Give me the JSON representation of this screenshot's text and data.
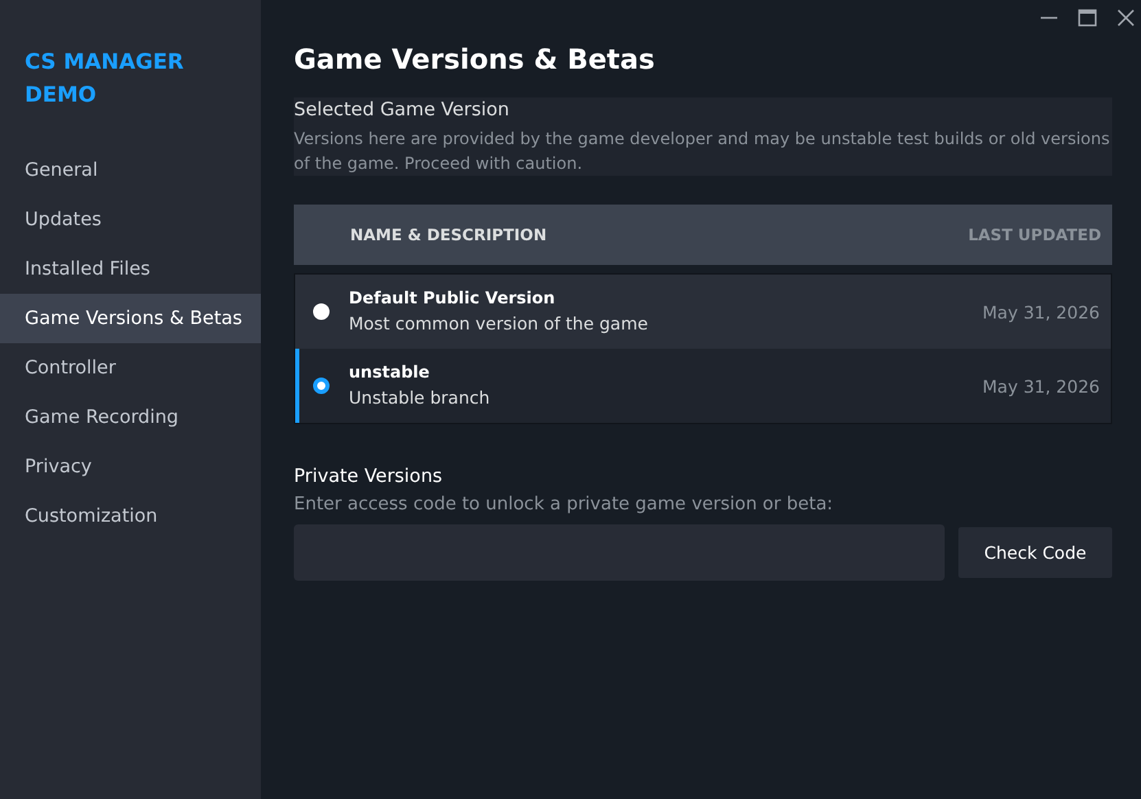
{
  "sidebar": {
    "title": "CS MANAGER DEMO",
    "items": [
      {
        "label": "General",
        "selected": false
      },
      {
        "label": "Updates",
        "selected": false
      },
      {
        "label": "Installed Files",
        "selected": false
      },
      {
        "label": "Game Versions & Betas",
        "selected": true
      },
      {
        "label": "Controller",
        "selected": false
      },
      {
        "label": "Game Recording",
        "selected": false
      },
      {
        "label": "Privacy",
        "selected": false
      },
      {
        "label": "Customization",
        "selected": false
      }
    ]
  },
  "page": {
    "title": "Game Versions & Betas"
  },
  "selected_version": {
    "heading": "Selected Game Version",
    "description": "Versions here are provided by the game developer and may be unstable test builds or old versions of the game. Proceed with caution."
  },
  "table": {
    "columns": [
      "NAME & DESCRIPTION",
      "LAST UPDATED"
    ],
    "rows": [
      {
        "name": "Default Public Version",
        "description": "Most common version of the game",
        "last_updated": "May 31, 2026",
        "selected": false
      },
      {
        "name": "unstable",
        "description": "Unstable branch",
        "last_updated": "May 31, 2026",
        "selected": true
      }
    ]
  },
  "private_versions": {
    "heading": "Private Versions",
    "description": "Enter access code to unlock a private game version or beta:",
    "button": "Check Code"
  }
}
